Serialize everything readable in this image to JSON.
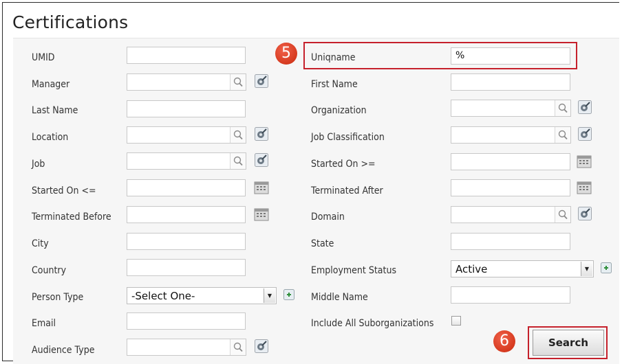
{
  "page": {
    "title": "Certifications"
  },
  "left_fields": [
    {
      "label": "UMID",
      "value": ""
    },
    {
      "label": "Manager",
      "value": ""
    },
    {
      "label": "Last Name",
      "value": ""
    },
    {
      "label": "Location",
      "value": ""
    },
    {
      "label": "Job",
      "value": ""
    },
    {
      "label": "Started On <=",
      "value": ""
    },
    {
      "label": "Terminated Before",
      "value": ""
    },
    {
      "label": "City",
      "value": ""
    },
    {
      "label": "Country",
      "value": ""
    },
    {
      "label": "Person Type",
      "value": "-Select One-"
    },
    {
      "label": "Email",
      "value": ""
    },
    {
      "label": "Audience Type",
      "value": ""
    }
  ],
  "right_fields": [
    {
      "label": "Uniqname",
      "value": "%"
    },
    {
      "label": "First Name",
      "value": ""
    },
    {
      "label": "Organization",
      "value": ""
    },
    {
      "label": "Job Classification",
      "value": ""
    },
    {
      "label": "Started On >=",
      "value": ""
    },
    {
      "label": "Terminated After",
      "value": ""
    },
    {
      "label": "Domain",
      "value": ""
    },
    {
      "label": "State",
      "value": ""
    },
    {
      "label": "Employment Status",
      "value": "Active"
    },
    {
      "label": "Middle Name",
      "value": ""
    },
    {
      "label": "Include All Suborganizations",
      "checked": false
    }
  ],
  "search_button": {
    "label": "Search"
  },
  "annotations": {
    "step_5": "5",
    "step_6": "6",
    "highlight_color": "#c5202b"
  }
}
